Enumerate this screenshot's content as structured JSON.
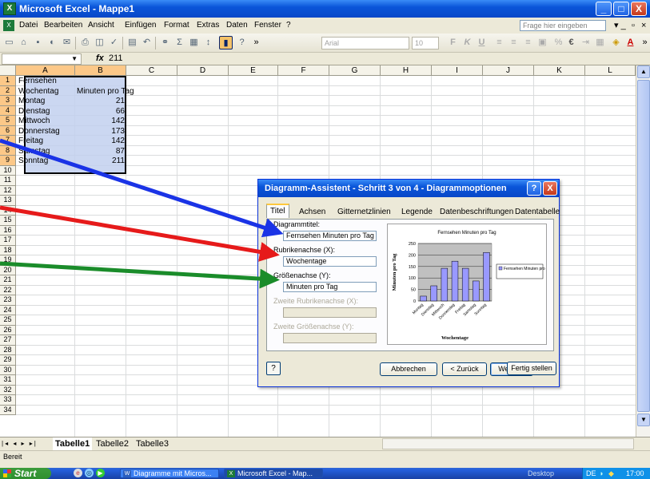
{
  "window": {
    "title": "Microsoft Excel - Mappe1",
    "minimize": "_",
    "maximize": "□",
    "close": "X"
  },
  "menu": {
    "items": [
      "Datei",
      "Bearbeiten",
      "Ansicht",
      "Einfügen",
      "Format",
      "Extras",
      "Daten",
      "Fenster",
      "?"
    ],
    "help_placeholder": "Frage hier eingeben"
  },
  "toolbar": {
    "font_name": "Arial",
    "font_size": "10",
    "bold": "F",
    "italic": "K",
    "underline": "U",
    "currency": "€",
    "font_color": "A"
  },
  "formula": {
    "fx_label": "fx",
    "value": "211"
  },
  "grid": {
    "columns": [
      "A",
      "B",
      "C",
      "D",
      "E",
      "F",
      "G",
      "H",
      "I",
      "J",
      "K",
      "L"
    ],
    "rows": [
      "1",
      "2",
      "3",
      "4",
      "5",
      "6",
      "7",
      "8",
      "9",
      "10",
      "11",
      "12",
      "13",
      "14",
      "15",
      "16",
      "17",
      "18",
      "19",
      "20",
      "21",
      "22",
      "23",
      "24",
      "25",
      "26",
      "27",
      "28",
      "29",
      "30",
      "31",
      "32",
      "33",
      "34"
    ],
    "cells": [
      {
        "a": "Fernsehen",
        "b": ""
      },
      {
        "a": "Wochentag",
        "b": "Minuten pro Tag"
      },
      {
        "a": "Montag",
        "b": "21"
      },
      {
        "a": "Dienstag",
        "b": "66"
      },
      {
        "a": "Mittwoch",
        "b": "142"
      },
      {
        "a": "Donnerstag",
        "b": "173"
      },
      {
        "a": "Freitag",
        "b": "142"
      },
      {
        "a": "Samstag",
        "b": "87"
      },
      {
        "a": "Sonntag",
        "b": "211"
      }
    ]
  },
  "sheets": {
    "nav": "|◂ ◂ ▸ ▸|",
    "tabs": [
      "Tabelle1",
      "Tabelle2",
      "Tabelle3"
    ]
  },
  "status": {
    "text": "Bereit"
  },
  "taskbar": {
    "start": "Start",
    "tasks": [
      "Diagramme mit Micros...",
      "Microsoft Excel - Map..."
    ],
    "desktop": "Desktop",
    "lang": "DE",
    "time": "17:00"
  },
  "dialog": {
    "title": "Diagramm-Assistent - Schritt 3 von 4 - Diagrammoptionen",
    "help_icon": "?",
    "close_icon": "X",
    "tabs": [
      "Titel",
      "Achsen",
      "Gitternetzlinien",
      "Legende",
      "Datenbeschriftungen",
      "Datentabelle"
    ],
    "fields": {
      "chart_title_label": "Diagrammtitel:",
      "chart_title_value": "Fernsehen Minuten pro Tag",
      "x_axis_label": "Rubrikenachse (X):",
      "x_axis_value": "Wochentage",
      "y_axis_label": "Größenachse (Y):",
      "y_axis_value": "Minuten pro Tag",
      "x2_axis_label": "Zweite Rubrikenachse (X):",
      "y2_axis_label": "Zweite Größenachse (Y):"
    },
    "buttons": {
      "help": "?",
      "cancel": "Abbrechen",
      "back": "< Zurück",
      "next": "Weiter >",
      "finish": "Fertig stellen"
    }
  },
  "chart_data": {
    "type": "bar",
    "title": "Fernsehen Minuten pro Tag",
    "xlabel": "Wochentage",
    "ylabel": "Minuten pro Tag",
    "categories": [
      "Montag",
      "Dienstag",
      "Mittwoch",
      "Donnerstag",
      "Freitag",
      "Samstag",
      "Sonntag"
    ],
    "series": [
      {
        "name": "Fernsehen Minuten pro Tag",
        "values": [
          21,
          66,
          142,
          173,
          142,
          87,
          211
        ]
      }
    ],
    "ylim": [
      0,
      250
    ],
    "yticks": [
      0,
      50,
      100,
      150,
      200,
      250
    ],
    "grid": true,
    "legend": "right",
    "bar_color": "#9999ff",
    "plot_bg": "#c0c0c0"
  },
  "annotations": {
    "arrow_colors": [
      "#1a33e6",
      "#e61a1a",
      "#1a8c2a"
    ]
  }
}
